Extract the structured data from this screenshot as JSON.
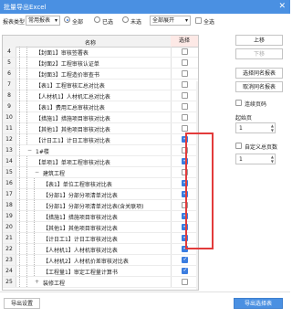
{
  "window": {
    "title": "批量导出Excel",
    "close_glyph": "✕"
  },
  "toolbar": {
    "type_label": "报表类型",
    "type_value": "常用报表",
    "radio_all": "全部",
    "radio_selected": "已选",
    "radio_unselected": "未选",
    "expand_value": "全部展开",
    "check_all": "全选"
  },
  "grid": {
    "header_name": "名称",
    "header_select": "选择",
    "rows": [
      {
        "num": "4",
        "indent": 2,
        "toggle": "",
        "label": "【封面1】审核签署表",
        "checked": false
      },
      {
        "num": "5",
        "indent": 2,
        "toggle": "",
        "label": "【封面2】工程审核认证单",
        "checked": false
      },
      {
        "num": "6",
        "indent": 2,
        "toggle": "",
        "label": "【封面3】工程造价审查书",
        "checked": false
      },
      {
        "num": "7",
        "indent": 2,
        "toggle": "",
        "label": "【表1】工程审核汇总对比表",
        "checked": false
      },
      {
        "num": "8",
        "indent": 2,
        "toggle": "",
        "label": "【人材机1】人材机汇总对比表",
        "checked": false
      },
      {
        "num": "9",
        "indent": 2,
        "toggle": "",
        "label": "【表1】费用汇总审核对比表",
        "checked": false
      },
      {
        "num": "10",
        "indent": 2,
        "toggle": "",
        "label": "【措施1】措施项目审核对比表",
        "checked": false
      },
      {
        "num": "11",
        "indent": 2,
        "toggle": "",
        "label": "【其他1】其他项目审核对比表",
        "checked": false
      },
      {
        "num": "12",
        "indent": 2,
        "toggle": "",
        "label": "【计日工1】计日工审核对比表",
        "checked": true
      },
      {
        "num": "13",
        "indent": 1,
        "toggle": "−",
        "label": "1#楼",
        "checked": false
      },
      {
        "num": "14",
        "indent": 2,
        "toggle": "",
        "label": "【单项1】单项工程审核对比表",
        "checked": true
      },
      {
        "num": "15",
        "indent": 2,
        "toggle": "−",
        "label": "建筑工程",
        "checked": false
      },
      {
        "num": "16",
        "indent": 3,
        "toggle": "",
        "label": "【表1】单位工程审核对比表",
        "checked": true
      },
      {
        "num": "17",
        "indent": 3,
        "toggle": "",
        "label": "【分部1】分部分项清单对比表",
        "checked": true
      },
      {
        "num": "18",
        "indent": 3,
        "toggle": "",
        "label": "【分部1】分部分项清单对比表(含关联项)",
        "checked": false
      },
      {
        "num": "19",
        "indent": 3,
        "toggle": "",
        "label": "【措施1】措施项目审核对比表",
        "checked": true
      },
      {
        "num": "20",
        "indent": 3,
        "toggle": "",
        "label": "【其他1】其他项目审核对比表",
        "checked": true
      },
      {
        "num": "21",
        "indent": 3,
        "toggle": "",
        "label": "【计日工1】计日工审核对比表",
        "checked": true
      },
      {
        "num": "22",
        "indent": 3,
        "toggle": "",
        "label": "【人材机1】人材机审核对比表",
        "checked": true
      },
      {
        "num": "23",
        "indent": 3,
        "toggle": "",
        "label": "【人材机2】人材机价差审核对比表",
        "checked": true
      },
      {
        "num": "24",
        "indent": 3,
        "toggle": "",
        "label": "【工程量1】审定工程量计算书",
        "checked": true
      },
      {
        "num": "25",
        "indent": 2,
        "toggle": "+",
        "label": "装修工程",
        "checked": false
      }
    ]
  },
  "side": {
    "up": "上移",
    "down": "下移",
    "select_same": "选择同名报表",
    "cancel_same": "取消同名报表",
    "continuous_page": "连续页码",
    "start_page_label": "起始页",
    "start_page_value": "1",
    "custom_total_label": "自定义总页数",
    "custom_total_value": "1"
  },
  "footer": {
    "export_settings": "导出设置",
    "export_selected": "导出选择表"
  }
}
